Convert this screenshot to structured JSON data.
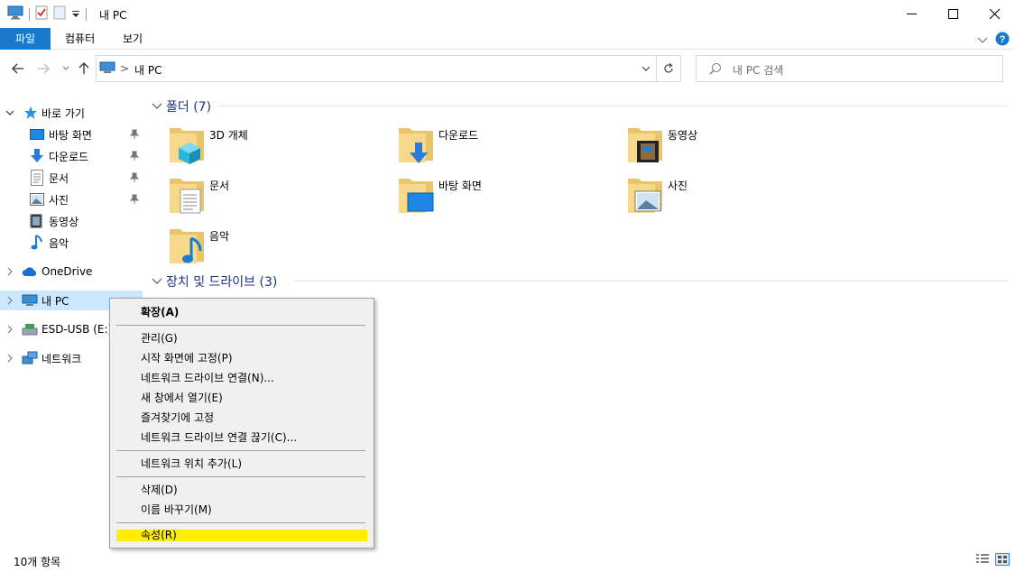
{
  "window": {
    "title": "내 PC"
  },
  "ribbon": {
    "tabs": [
      "파일",
      "컴퓨터",
      "보기"
    ]
  },
  "address": {
    "path": "내 PC",
    "separator": ">"
  },
  "search": {
    "placeholder": "내 PC 검색"
  },
  "nav": {
    "quick_access": "바로 가기",
    "quick_items": [
      "바탕 화면",
      "다운로드",
      "문서",
      "사진",
      "동영상",
      "음악"
    ],
    "onedrive": "OneDrive",
    "this_pc": "내 PC",
    "usb": "ESD-USB (E:)",
    "network": "네트워크"
  },
  "content": {
    "folders_header": "폴더 (7)",
    "folders": [
      "3D 개체",
      "다운로드",
      "동영상",
      "문서",
      "바탕 화면",
      "사진",
      "음악"
    ],
    "devices_header": "장치 및 드라이브 (3)"
  },
  "status": {
    "item_count": "10개 항목"
  },
  "context_menu": {
    "items": [
      "확장(A)",
      "관리(G)",
      "시작 화면에 고정(P)",
      "네트워크 드라이브 연결(N)...",
      "새 창에서 열기(E)",
      "즐겨찾기에 고정",
      "네트워크 드라이브 연결 끊기(C)...",
      "네트워크 위치 추가(L)",
      "삭제(D)",
      "이름 바꾸기(M)",
      "속성(R)"
    ]
  },
  "colors": {
    "accent": "#1979ca",
    "selection": "#cce8ff",
    "highlight": "#ffee00",
    "header_text": "#1e3287"
  }
}
